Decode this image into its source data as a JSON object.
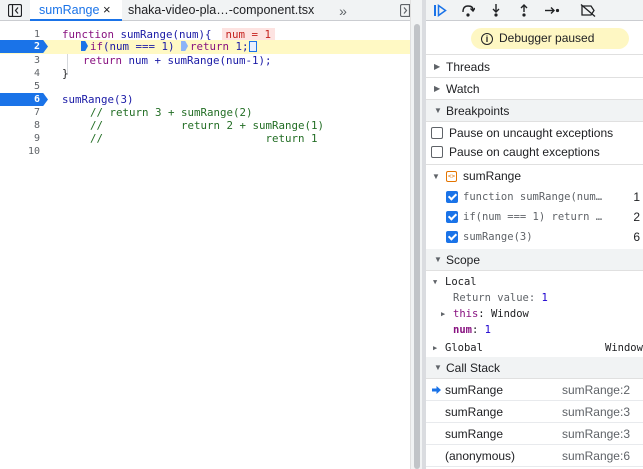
{
  "tabs": {
    "active": "sumRange",
    "active_close": "×",
    "second": "shaka-video-pla…-component.tsx",
    "overflow": "»"
  },
  "editor": {
    "lines": [
      {
        "n": "1"
      },
      {
        "n": "2"
      },
      {
        "n": "3"
      },
      {
        "n": "4"
      },
      {
        "n": "5"
      },
      {
        "n": "6"
      },
      {
        "n": "7"
      },
      {
        "n": "8"
      },
      {
        "n": "9"
      },
      {
        "n": "10"
      }
    ],
    "code": {
      "l1_kw": "function",
      "l1_rest": " sumRange(num){",
      "l1_inline": "num = 1",
      "l2_kw": "if",
      "l2_mid": "(num === 1) ",
      "l2_kw2": "return",
      "l2_rest": " 1;",
      "l3_kw": "return",
      "l3_rest": " num + sumRange(num-1);",
      "l4": "}",
      "l6": "sumRange(3)",
      "l7": "// return 3 + sumRange(2)",
      "l8": "//            return 2 + sumRange(1)",
      "l9": "//                         return 1"
    }
  },
  "debugger": {
    "paused_text": "Debugger paused",
    "info_glyph": "i"
  },
  "sections": {
    "threads": "Threads",
    "watch": "Watch",
    "breakpoints": "Breakpoints",
    "scope": "Scope",
    "call_stack": "Call Stack"
  },
  "exceptions": {
    "uncaught": "Pause on uncaught exceptions",
    "caught": "Pause on caught exceptions"
  },
  "breakpoint_file": {
    "name": "sumRange",
    "icon_glyph": "<>"
  },
  "breakpoint_items": [
    {
      "text": "function sumRange(num…",
      "line": "1"
    },
    {
      "text": "if(num === 1) return …",
      "line": "2"
    },
    {
      "text": "sumRange(3)",
      "line": "6"
    }
  ],
  "scope": {
    "local_label": "Local",
    "return_key": "Return value",
    "return_val": "1",
    "this_key": "this",
    "this_val": "Window",
    "num_key": "num",
    "num_val": "1",
    "global_label": "Global",
    "global_val": "Window"
  },
  "call_stack": [
    {
      "fn": "sumRange",
      "loc": "sumRange:2",
      "current": true
    },
    {
      "fn": "sumRange",
      "loc": "sumRange:3",
      "current": false
    },
    {
      "fn": "sumRange",
      "loc": "sumRange:3",
      "current": false
    },
    {
      "fn": "(anonymous)",
      "loc": "sumRange:6",
      "current": false
    }
  ],
  "colors": {
    "accent": "#1a73e8",
    "paused_banner": "#fef7c3",
    "exec_line": "#fff9c4"
  }
}
